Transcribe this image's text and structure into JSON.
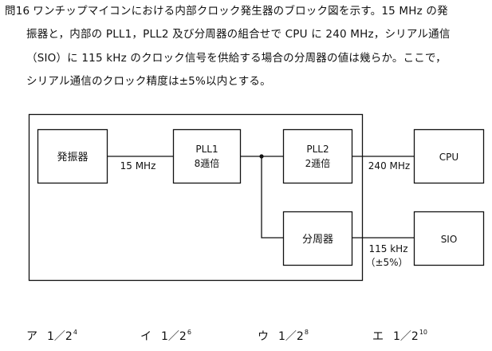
{
  "question": {
    "number": "問16",
    "lines": [
      "ワンチップマイコンにおける内部クロック発生器のブロック図を示す。15 MHz の発",
      "振器と，内部の PLL1，PLL2 及び分周器の組合せで CPU に 240 MHz，シリアル通信",
      "（SIO）に 115 kHz のクロック信号を供給する場合の分周器の値は幾らか。ここで，",
      "シリアル通信のクロック精度は±5%以内とする。"
    ]
  },
  "diagram": {
    "blocks": {
      "oscillator": "発振器",
      "pll1_name": "PLL1",
      "pll1_mult": "8逓倍",
      "pll2_name": "PLL2",
      "pll2_mult": "2逓倍",
      "divider": "分周器",
      "cpu": "CPU",
      "sio": "SIO"
    },
    "signals": {
      "osc_out": "15 MHz",
      "cpu_in": "240 MHz",
      "sio_in": "115 kHz",
      "sio_tolerance": "（±5%）"
    }
  },
  "choices": [
    {
      "mark": "ア",
      "base": "1／2",
      "exp": "4"
    },
    {
      "mark": "イ",
      "base": "1／2",
      "exp": "6"
    },
    {
      "mark": "ウ",
      "base": "1／2",
      "exp": "8"
    },
    {
      "mark": "エ",
      "base": "1／2",
      "exp": "10"
    }
  ]
}
